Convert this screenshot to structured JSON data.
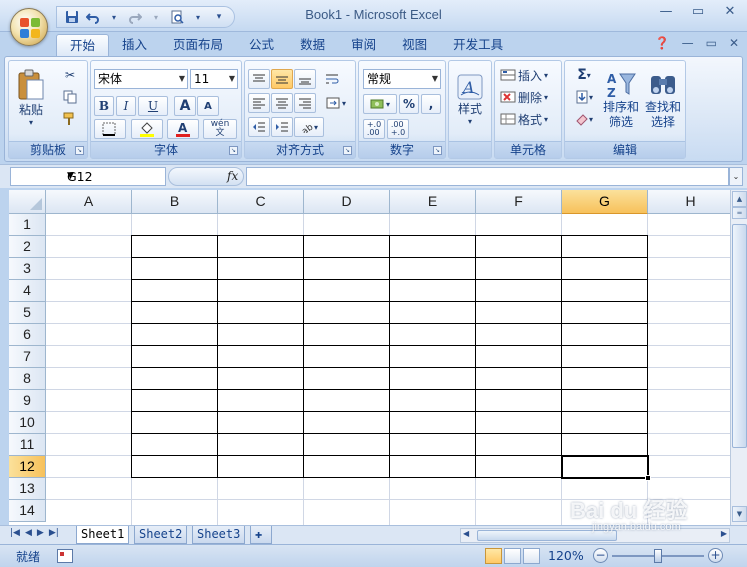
{
  "window": {
    "title": "Book1 - Microsoft Excel",
    "controls": [
      "—",
      "▭",
      "✕"
    ]
  },
  "qat": {
    "save_icon": "save-icon",
    "undo_icon": "undo-icon",
    "redo_icon": "redo-icon",
    "print_preview_icon": "print-preview-icon"
  },
  "ribbon": {
    "tabs": [
      "开始",
      "插入",
      "页面布局",
      "公式",
      "数据",
      "审阅",
      "视图",
      "开发工具"
    ],
    "active_tab": "开始",
    "groups": {
      "clipboard": {
        "label": "剪贴板",
        "paste": "粘贴"
      },
      "font": {
        "label": "字体",
        "font_name": "宋体",
        "font_size": "11",
        "bold": "B",
        "italic": "I",
        "underline": "U",
        "grow": "A",
        "shrink": "A",
        "phonetic": "wén\n文"
      },
      "alignment": {
        "label": "对齐方式"
      },
      "number": {
        "label": "数字",
        "format": "常规",
        "percent": "%",
        "comma": ",",
        "inc_decimal": "+.0\n.00",
        "dec_decimal": ".00\n+.0"
      },
      "styles": {
        "label": "",
        "styles_btn": "样式"
      },
      "cells": {
        "label": "单元格",
        "insert": "插入",
        "delete": "删除",
        "format": "格式"
      },
      "editing": {
        "label": "编辑",
        "sigma": "Σ",
        "sort_filter": "排序和\n筛选",
        "find_select": "查找和\n选择"
      }
    }
  },
  "formula_bar": {
    "name_box": "G12",
    "fx_label": "fx",
    "formula": ""
  },
  "grid": {
    "columns": [
      "A",
      "B",
      "C",
      "D",
      "E",
      "F",
      "G",
      "H"
    ],
    "rows": [
      "1",
      "2",
      "3",
      "4",
      "5",
      "6",
      "7",
      "8",
      "9",
      "10",
      "11",
      "12",
      "13",
      "14"
    ],
    "selected_column": "G",
    "selected_row": "12",
    "bordered_range": "B2:G12"
  },
  "sheets": {
    "tabs": [
      "Sheet1",
      "Sheet2",
      "Sheet3"
    ],
    "active": "Sheet1"
  },
  "status": {
    "ready": "就绪",
    "zoom": "120%"
  },
  "watermark": {
    "brand": "Bai du 经验",
    "url": "jingyan.baidu.com"
  }
}
